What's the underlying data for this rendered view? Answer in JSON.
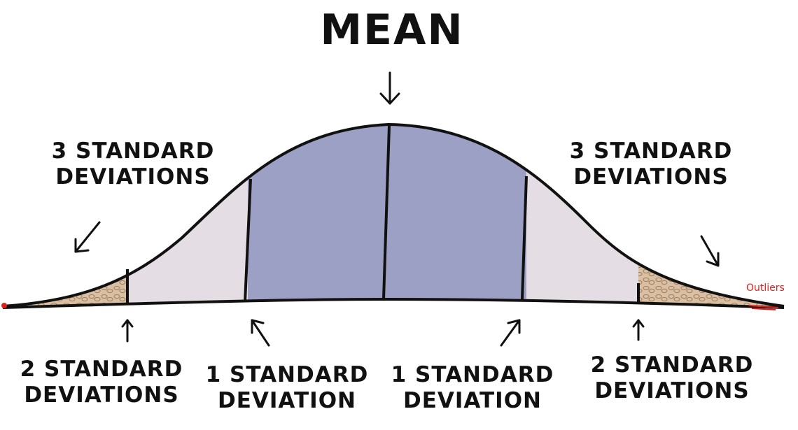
{
  "title": "MEAN",
  "labels": {
    "three_sd_left": {
      "line1": "3 STANDARD",
      "line2": "DEVIATIONS"
    },
    "three_sd_right": {
      "line1": "3 STANDARD",
      "line2": "DEVIATIONS"
    },
    "two_sd_left": {
      "line1": "2 STANDARD",
      "line2": "DEVIATIONS"
    },
    "one_sd_left": {
      "line1": "1 STANDARD",
      "line2": "DEVIATION"
    },
    "one_sd_right": {
      "line1": "1 STANDARD",
      "line2": "DEVIATION"
    },
    "two_sd_right": {
      "line1": "2 STANDARD",
      "line2": "DEVIATIONS"
    }
  },
  "outliers_label": "Outliers",
  "colors": {
    "ink": "#111111",
    "inner_band": "#9ca0c4",
    "middle_band": "#e4dde3",
    "outer_band": "#c9a98a",
    "outlier": "#e0201c"
  }
}
